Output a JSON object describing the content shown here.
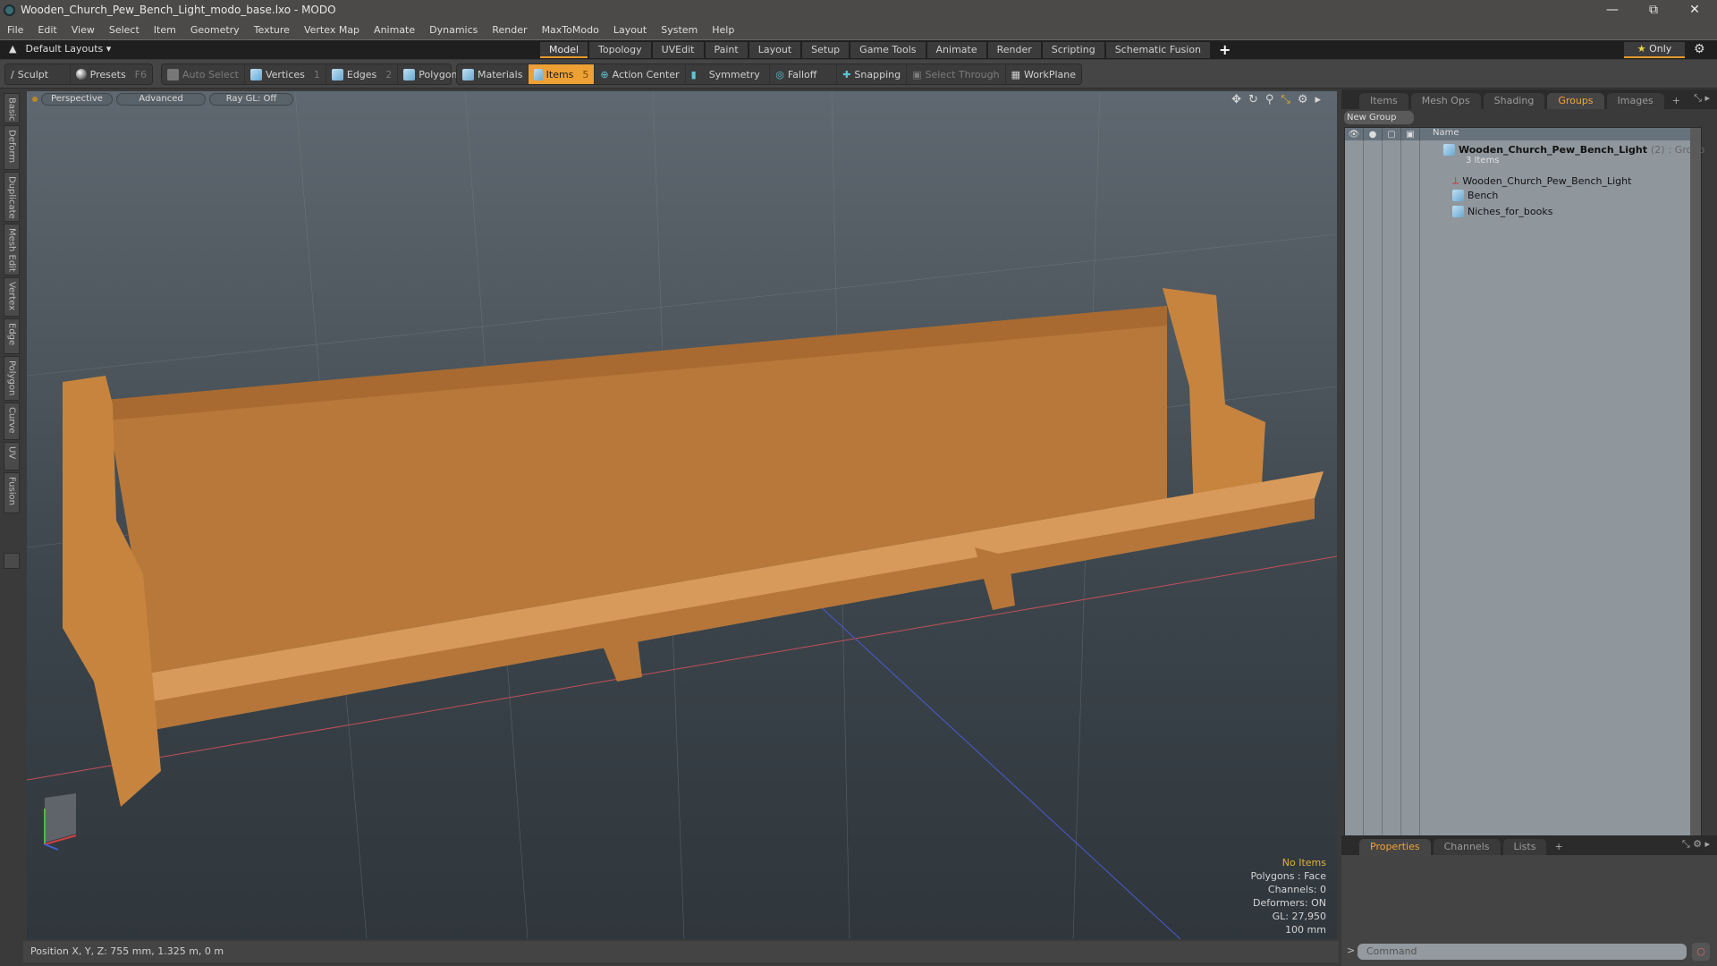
{
  "window": {
    "title": "Wooden_Church_Pew_Bench_Light_modo_base.lxo - MODO",
    "controls": [
      "minimize",
      "restore",
      "close"
    ]
  },
  "menu": [
    "File",
    "Edit",
    "View",
    "Select",
    "Item",
    "Geometry",
    "Texture",
    "Vertex Map",
    "Animate",
    "Dynamics",
    "Render",
    "MaxToModo",
    "Layout",
    "System",
    "Help"
  ],
  "layoutbar": {
    "layouts_label": "Default Layouts ▾",
    "tabs": [
      "Model",
      "Topology",
      "UVEdit",
      "Paint",
      "Layout",
      "Setup",
      "Game Tools",
      "Animate",
      "Render",
      "Scripting",
      "Schematic Fusion"
    ],
    "active_tab": "Model",
    "add_label": "+",
    "only_label": "Only"
  },
  "toolbar": {
    "sculpt": "Sculpt",
    "presets": "Presets",
    "presets_key": "F6",
    "auto_select": "Auto Select",
    "vertices": "Vertices",
    "vertices_key": "1",
    "edges": "Edges",
    "edges_key": "2",
    "polygons": "Polygons",
    "materials": "Materials",
    "items": "Items",
    "items_key": "5",
    "action_center": "Action Center",
    "symmetry": "Symmetry",
    "falloff": "Falloff",
    "snapping": "Snapping",
    "select_through": "Select Through",
    "workplane": "WorkPlane"
  },
  "left_tabs": [
    "Basic",
    "Deform",
    "Duplicate",
    "Mesh Edit",
    "Vertex",
    "Edge",
    "Polygon",
    "Curve",
    "UV",
    "Fusion"
  ],
  "viewport": {
    "view": "Perspective",
    "shading": "Advanced",
    "raygl": "Ray GL: Off",
    "info": {
      "selection": "No Items",
      "polygons": "Polygons : Face",
      "channels": "Channels: 0",
      "deformers": "Deformers: ON",
      "gl": "GL: 27,950",
      "grid": "100 mm"
    }
  },
  "status": {
    "position": "Position X, Y, Z:   755 mm, 1.325 m, 0 m"
  },
  "right_panel": {
    "tabs": [
      "Items",
      "Mesh Ops",
      "Shading",
      "Groups",
      "Images"
    ],
    "active_tab": "Groups",
    "new_group": "New Group",
    "name_header": "Name",
    "group": {
      "name": "Wooden_Church_Pew_Bench_Light",
      "count": "(2)",
      "type": ": Group",
      "sub": "3 Items"
    },
    "items": [
      "Wooden_Church_Pew_Bench_Light",
      "Bench",
      "Niches_for_books"
    ],
    "bottom_tabs": [
      "Properties",
      "Channels",
      "Lists"
    ],
    "bottom_active": "Properties",
    "command_placeholder": "Command"
  },
  "colors": {
    "accent": "#eda033",
    "viewport_bg": "#3b444b"
  }
}
